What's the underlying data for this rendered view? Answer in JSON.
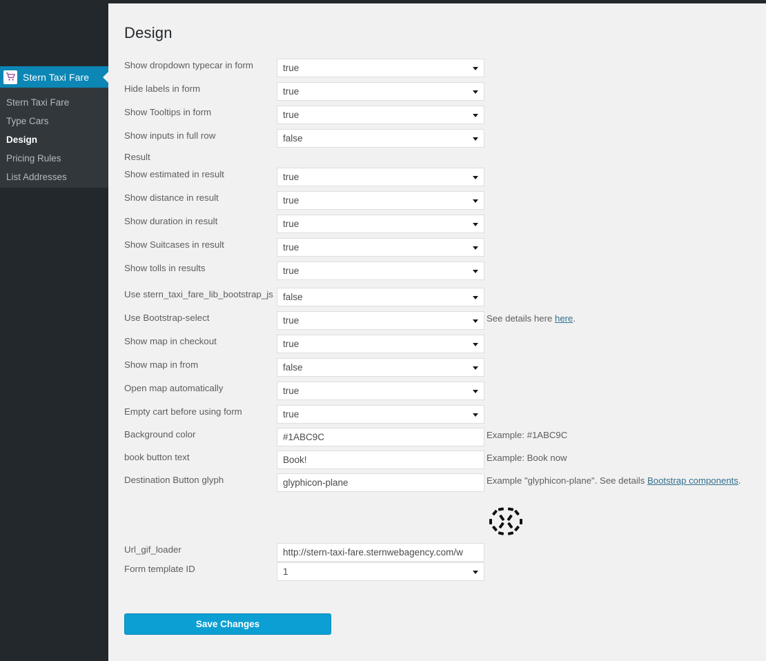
{
  "sidebar": {
    "menu_head": {
      "label": "Stern Taxi Fare",
      "icon": "cart-icon"
    },
    "items": [
      {
        "label": "Stern Taxi Fare",
        "current": false
      },
      {
        "label": "Type Cars",
        "current": false
      },
      {
        "label": "Design",
        "current": true
      },
      {
        "label": "Pricing Rules",
        "current": false
      },
      {
        "label": "List Addresses",
        "current": false
      }
    ]
  },
  "main": {
    "title": "Design",
    "save_label": "Save Changes",
    "rows": [
      {
        "label": "Show dropdown typecar in form",
        "type": "select",
        "value": "true"
      },
      {
        "label": "Hide labels in form",
        "type": "select",
        "value": "true"
      },
      {
        "label": "Show Tooltips in form",
        "type": "select",
        "value": "true"
      },
      {
        "label": "Show inputs in full row",
        "type": "select",
        "value": "false"
      },
      {
        "label": "Result",
        "type": "section"
      },
      {
        "label": "Show estimated in result",
        "type": "select",
        "value": "true"
      },
      {
        "label": "Show distance in result",
        "type": "select",
        "value": "true"
      },
      {
        "label": "Show duration in result",
        "type": "select",
        "value": "true"
      },
      {
        "label": "Show Suitcases in result",
        "type": "select",
        "value": "true"
      },
      {
        "label": "Show tolls in results",
        "type": "select",
        "value": "true"
      },
      {
        "label": "Use stern_taxi_fare_lib_bootstrap_js",
        "type": "select",
        "value": "false"
      },
      {
        "label": "Use Bootstrap-select",
        "type": "select",
        "value": "true",
        "hint_before": "See details here ",
        "hint_link": "here",
        "hint_after": "."
      },
      {
        "label": "Show map in checkout",
        "type": "select",
        "value": "true"
      },
      {
        "label": "Show map in from",
        "type": "select",
        "value": "false"
      },
      {
        "label": "Open map automatically",
        "type": "select",
        "value": "true"
      },
      {
        "label": "Empty cart before using form",
        "type": "select",
        "value": "true"
      },
      {
        "label": "Background color",
        "type": "text",
        "value": "#1ABC9C",
        "hint_before": "Example: #1ABC9C"
      },
      {
        "label": "book button text",
        "type": "text",
        "value": "Book!",
        "hint_before": "Example: Book now"
      },
      {
        "label": "Destination Button glyph",
        "type": "text",
        "value": "glyphicon-plane",
        "hint_before": "Example \"glyphicon-plane\". See details ",
        "hint_link": "Bootstrap components",
        "hint_after": "."
      },
      {
        "label": "Url_gif_loader",
        "type": "text",
        "value": "http://stern-taxi-fare.sternwebagency.com/w"
      },
      {
        "label": "Form template ID",
        "type": "select",
        "value": "1"
      }
    ]
  },
  "colors": {
    "accent_blue": "#0c9fd4",
    "sidebar_dark": "#23282d",
    "submenu_dark": "#32373c",
    "menu_head_blue": "#0c86b5",
    "link": "#31708f",
    "page_bg": "#f1f1f1"
  },
  "layout": {
    "row_tops": [
      80,
      114,
      148,
      182,
      213,
      238,
      272,
      306,
      340,
      374,
      412,
      446,
      480,
      514,
      548,
      582,
      615,
      648,
      681,
      782,
      810
    ]
  }
}
